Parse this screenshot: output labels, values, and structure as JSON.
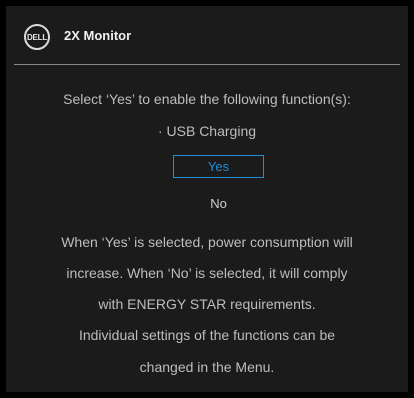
{
  "header": {
    "logo_text": "DELL",
    "title": "2X Monitor"
  },
  "prompt": {
    "instruction": "Select ‘Yes’ to enable the following function(s):",
    "functions": [
      "· USB Charging"
    ]
  },
  "options": {
    "yes_label": "Yes",
    "no_label": "No",
    "selected": "Yes"
  },
  "note": {
    "lines": [
      "When ‘Yes’ is selected, power consumption will",
      "increase. When ‘No’ is selected, it will comply",
      "with ENERGY STAR requirements.",
      "Individual settings of the functions can be",
      "changed in the Menu."
    ]
  },
  "colors": {
    "accent": "#1f8fd6",
    "background": "#1b1b1b",
    "text": "#bdbdbd"
  }
}
